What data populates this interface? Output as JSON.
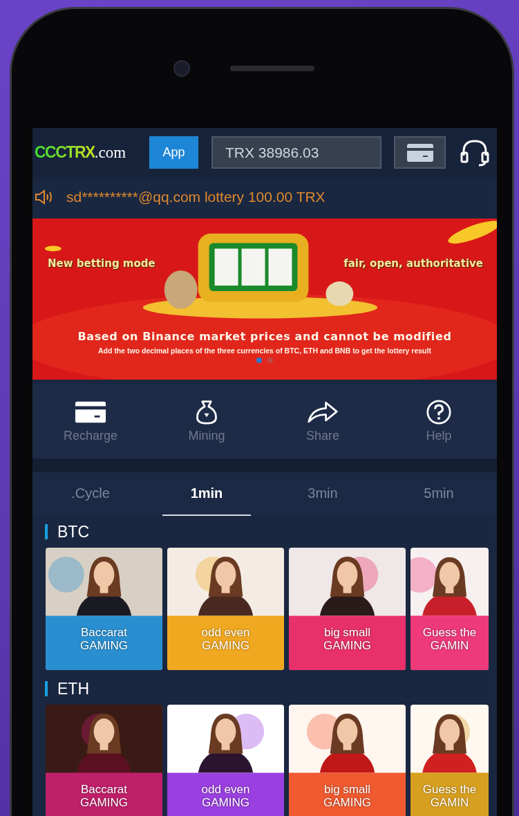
{
  "header": {
    "logo": {
      "brand": "CCCTRX",
      "suffix": ".com"
    },
    "app_button": "App",
    "balance": "TRX 38986.03"
  },
  "notice": "sd**********@qq.com lottery 100.00 TRX",
  "banner": {
    "kind": "picture",
    "headline_left": "New betting mode",
    "headline_right": "fair, open, authoritative",
    "caption": "Based on Binance market prices and cannot be modified",
    "subcaption": "Add the two decimal places of the three currencies of BTC, ETH and BNB to get the lottery result",
    "dots": [
      {
        "selected": true
      },
      {
        "selected": false
      }
    ]
  },
  "quick_menu": [
    {
      "kind": "card",
      "label": "Recharge"
    },
    {
      "kind": "bag",
      "label": "Mining"
    },
    {
      "kind": "share",
      "label": "Share"
    },
    {
      "kind": "help",
      "label": "Help"
    }
  ],
  "tabs": [
    {
      "label": ".Cycle",
      "selected": false
    },
    {
      "label": "1min",
      "selected": true
    },
    {
      "label": "3min",
      "selected": false
    },
    {
      "label": "5min",
      "selected": false
    }
  ],
  "sections": [
    {
      "title": "BTC",
      "games": [
        {
          "title": "Baccarat",
          "subtitle": "GAMING"
        },
        {
          "title": "odd even",
          "subtitle": "GAMING"
        },
        {
          "title": "big small",
          "subtitle": "GAMING"
        },
        {
          "title": "Guess the",
          "subtitle": "GAMIN"
        }
      ]
    },
    {
      "title": "ETH",
      "games": [
        {
          "title": "Baccarat",
          "subtitle": "GAMING"
        },
        {
          "title": "odd even",
          "subtitle": "GAMING"
        },
        {
          "title": "big small",
          "subtitle": "GAMING"
        },
        {
          "title": "Guess the",
          "subtitle": "GAMIN"
        }
      ]
    }
  ]
}
